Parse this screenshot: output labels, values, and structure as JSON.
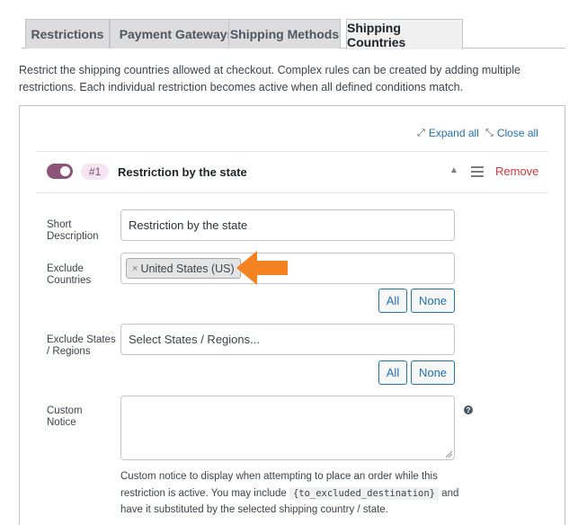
{
  "tabs": [
    {
      "label": "Restrictions",
      "active": false
    },
    {
      "label": "Payment Gateways",
      "active": false
    },
    {
      "label": "Shipping Methods",
      "active": false
    },
    {
      "label": "Shipping Countries",
      "active": true
    }
  ],
  "intro": "Restrict the shipping countries allowed at checkout. Complex rules can be created by adding multiple restrictions. Each individual restriction becomes active when all defined conditions match.",
  "toolbar": {
    "expand_all": "Expand all",
    "close_all": "Close all"
  },
  "rule": {
    "number": "#1",
    "title": "Restriction by the state",
    "remove": "Remove",
    "enabled": true
  },
  "fields": {
    "short_description": {
      "label": "Short Description",
      "value": "Restriction by the state"
    },
    "exclude_countries": {
      "label": "Exclude Countries",
      "chip": "United States (US)",
      "chip_remove": "×",
      "all": "All",
      "none": "None"
    },
    "exclude_states": {
      "label": "Exclude States / Regions",
      "placeholder": "Select States / Regions...",
      "all": "All",
      "none": "None"
    },
    "custom_notice": {
      "label": "Custom Notice",
      "value": "",
      "help": "?",
      "desc_before": "Custom notice to display when attempting to place an order while this restriction is active. You may include",
      "desc_code": "{to_excluded_destination}",
      "desc_after": "and have it substituted by the selected shipping country / state."
    }
  },
  "colors": {
    "accent": "#2271b1",
    "toggle": "#8c5479",
    "remove": "#d63638",
    "arrow": "#f58220"
  }
}
